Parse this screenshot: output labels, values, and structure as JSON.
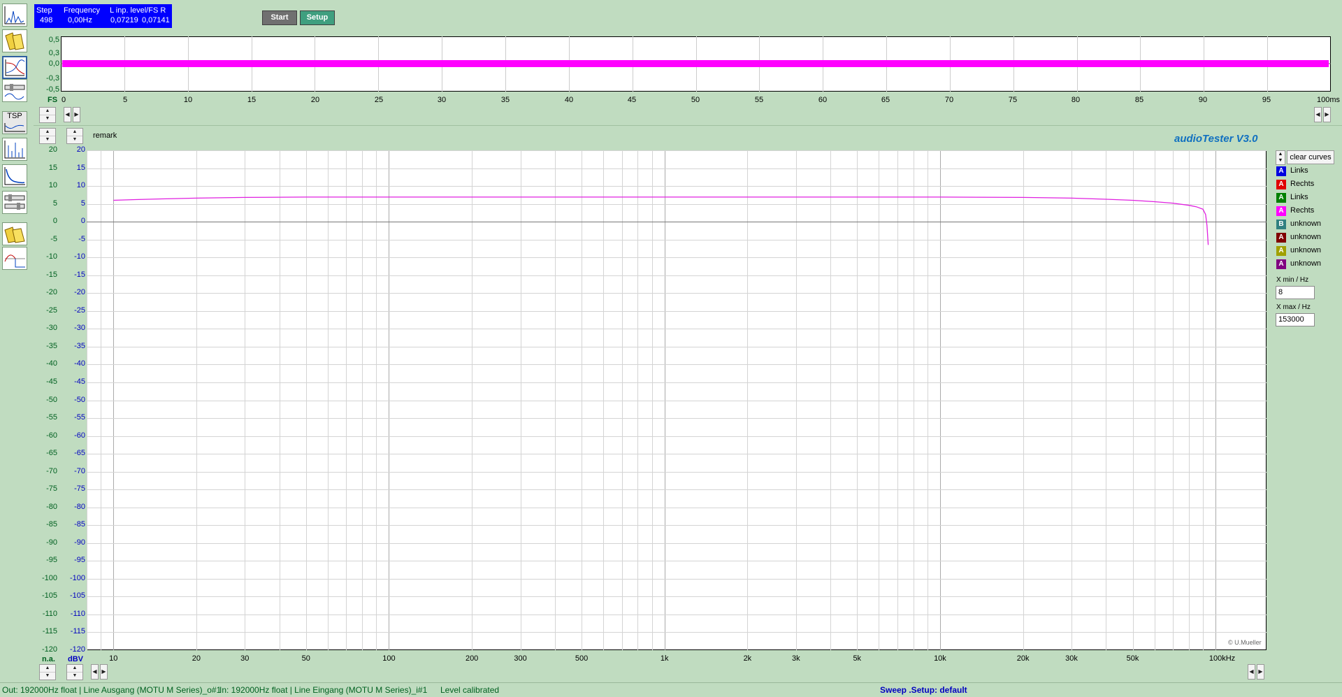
{
  "toolbar_icons": [
    "fft-spectrum-icon",
    "folder-files-icon",
    "sweep-response-icon",
    "filter-gauge-icon",
    "wave-icon",
    "tsp-icon",
    "spectrum-bars-icon",
    "step-response-icon",
    "gauge-settings-icon",
    "folder-yellow-icon",
    "waveform-square-icon"
  ],
  "tsp_label": "TSP",
  "status": {
    "step_label": "Step",
    "step_value": "498",
    "freq_label": "Frequency",
    "freq_value": "0,00Hz",
    "level_label": "L  inp. level/FS  R",
    "level_left": "0,07219",
    "level_right": "0,07141"
  },
  "buttons": {
    "start": "Start",
    "setup": "Setup"
  },
  "scope": {
    "y_ticks": [
      "0,5",
      "0,3",
      "0,0",
      "-0,3",
      "-0,5"
    ],
    "unit_label": "FS",
    "x_ticks": [
      "0",
      "5",
      "10",
      "15",
      "20",
      "25",
      "30",
      "35",
      "40",
      "45",
      "50",
      "55",
      "60",
      "65",
      "70",
      "75",
      "80",
      "85",
      "90",
      "95",
      "100ms"
    ],
    "signal_color": "#ff00ff"
  },
  "main": {
    "remark": "remark",
    "brand": "audioTester  V3.0",
    "copyright": "© U.Mueller",
    "y_ticks": [
      "20",
      "15",
      "10",
      "5",
      "0",
      "-5",
      "-10",
      "-15",
      "-20",
      "-25",
      "-30",
      "-35",
      "-40",
      "-45",
      "-50",
      "-55",
      "-60",
      "-65",
      "-70",
      "-75",
      "-80",
      "-85",
      "-90",
      "-95",
      "-100",
      "-105",
      "-110",
      "-115",
      "-120"
    ],
    "left_unit": "n.a.",
    "right_unit": "dBV",
    "x_ticks": [
      {
        "f": 10,
        "label": "10"
      },
      {
        "f": 20,
        "label": "20"
      },
      {
        "f": 30,
        "label": "30"
      },
      {
        "f": 50,
        "label": "50"
      },
      {
        "f": 100,
        "label": "100"
      },
      {
        "f": 200,
        "label": "200"
      },
      {
        "f": 300,
        "label": "300"
      },
      {
        "f": 500,
        "label": "500"
      },
      {
        "f": 1000,
        "label": "1k"
      },
      {
        "f": 2000,
        "label": "2k"
      },
      {
        "f": 3000,
        "label": "3k"
      },
      {
        "f": 5000,
        "label": "5k"
      },
      {
        "f": 10000,
        "label": "10k"
      },
      {
        "f": 20000,
        "label": "20k"
      },
      {
        "f": 30000,
        "label": "30k"
      },
      {
        "f": 50000,
        "label": "50k"
      },
      {
        "f": 100000,
        "label": "100kHz"
      }
    ]
  },
  "chart_data": {
    "type": "line",
    "xlabel": "",
    "ylabel": "",
    "x_scale": "log",
    "xlim": [
      8,
      153000
    ],
    "ylim": [
      -120,
      20
    ],
    "grid": true,
    "series": [
      {
        "name": "Rechts",
        "color": "#e020e0",
        "x": [
          10,
          12,
          15,
          20,
          30,
          50,
          100,
          1000,
          10000,
          20000,
          30000,
          40000,
          50000,
          60000,
          70000,
          80000,
          85000,
          90000,
          92000,
          93000,
          94000
        ],
        "y": [
          6.0,
          6.2,
          6.4,
          6.6,
          6.8,
          6.9,
          6.9,
          6.9,
          6.9,
          6.8,
          6.6,
          6.3,
          6.0,
          5.6,
          5.2,
          4.6,
          4.2,
          3.5,
          2.0,
          -1.0,
          -6.5
        ]
      }
    ]
  },
  "legend": {
    "clear_label": "clear curves",
    "items": [
      {
        "letter": "A",
        "color": "#0000e0",
        "label": "Links"
      },
      {
        "letter": "A",
        "color": "#e00000",
        "label": "Rechts"
      },
      {
        "letter": "A",
        "color": "#008000",
        "label": "Links"
      },
      {
        "letter": "A",
        "color": "#ff00ff",
        "label": "Rechts"
      },
      {
        "letter": "B",
        "color": "#308080",
        "label": "unknown"
      },
      {
        "letter": "A",
        "color": "#800000",
        "label": "unknown"
      },
      {
        "letter": "A",
        "color": "#a0a000",
        "label": "unknown"
      },
      {
        "letter": "A",
        "color": "#800080",
        "label": "unknown"
      }
    ],
    "xmin_label": "X min / Hz",
    "xmin_value": "8",
    "xmax_label": "X max / Hz",
    "xmax_value": "153000"
  },
  "statusbar": {
    "out": "Out: 192000Hz float  | Line Ausgang (MOTU M Series)_o#1",
    "in": "In: 192000Hz float  | Line Eingang (MOTU M Series)_i#1",
    "level": "Level calibrated",
    "sweep": "Sweep  .Setup:  default"
  }
}
